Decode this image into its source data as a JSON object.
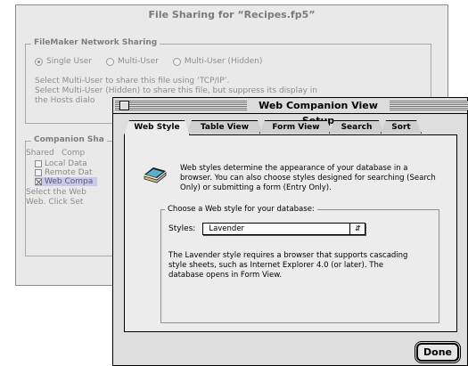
{
  "background_dialog": {
    "title": "File Sharing for “Recipes.fp5”",
    "network_group_label": "FileMaker Network Sharing",
    "options": [
      "Single User",
      "Multi-User",
      "Multi-User (Hidden)"
    ],
    "selected_option": "Single User",
    "help_lines": [
      "Select Multi-User to share this file using ‘TCP/IP’.",
      "Select Multi-User (Hidden) to share this file, but suppress its display in",
      "the Hosts dialo"
    ],
    "companion_group_label": "Companion Sha",
    "columns": [
      "Shared",
      "Comp"
    ],
    "companion_items": [
      {
        "label": "Local Data",
        "checked": false,
        "selected": false
      },
      {
        "label": "Remote Dat",
        "checked": false,
        "selected": false
      },
      {
        "label": "Web Compa",
        "checked": true,
        "selected": true
      }
    ],
    "footer_lines": [
      "Select the Web",
      "Web. Click Set"
    ]
  },
  "dialog": {
    "title": "Web Companion View Setup",
    "tabs": [
      {
        "label": "Web Style",
        "active": true
      },
      {
        "label": "Table View",
        "active": false
      },
      {
        "label": "Form View",
        "active": false
      },
      {
        "label": "Search",
        "active": false
      },
      {
        "label": "Sort",
        "active": false
      }
    ],
    "intro": "Web styles determine the appearance of your database in a browser.  You can also choose styles designed for searching (Search Only) or submitting a form (Entry Only).",
    "group_label": "Choose a Web style for your database:",
    "styles_label": "Styles:",
    "styles_value": "Lavender",
    "description": "The Lavender style requires a browser that supports cascading style sheets, such as Internet Explorer 4.0 (or later). The database opens in Form View.",
    "done_label": "Done"
  }
}
